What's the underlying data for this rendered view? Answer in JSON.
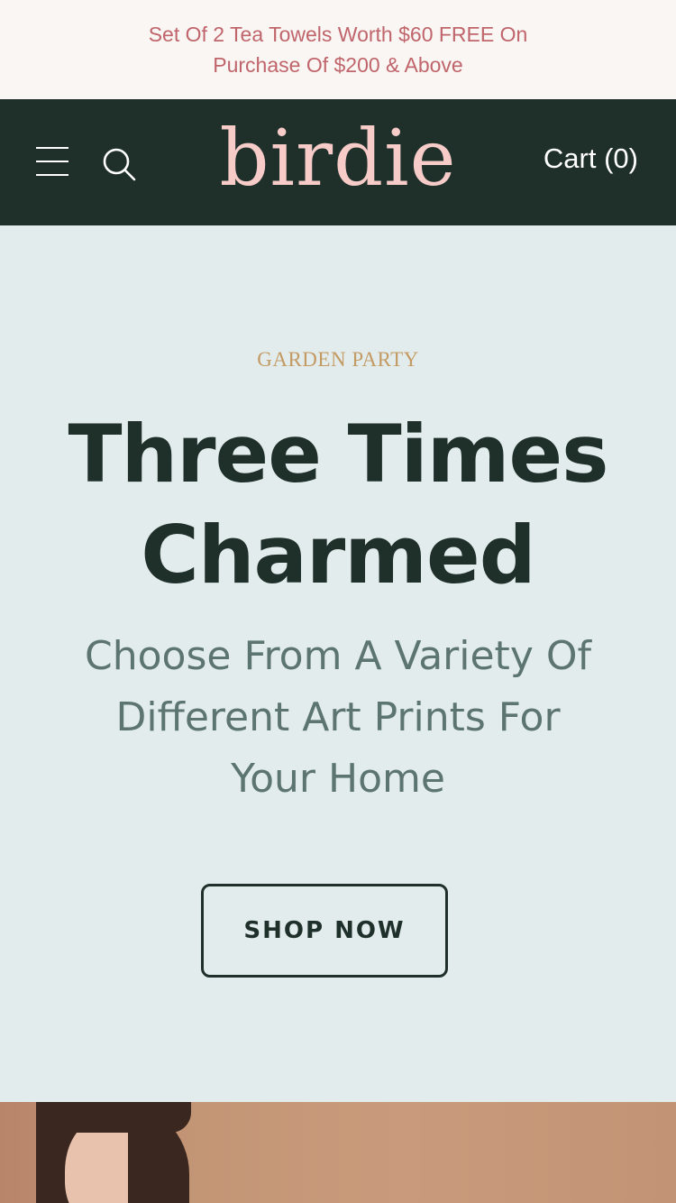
{
  "announcement": {
    "text": "Set Of 2 Tea Towels Worth $60 FREE On Purchase Of $200 & Above"
  },
  "header": {
    "menu_icon": "hamburger-menu-icon",
    "search_icon": "search-icon",
    "logo": "birdie",
    "cart_label": "Cart (0)"
  },
  "hero": {
    "eyebrow": "GARDEN PARTY",
    "headline": "Three Times Charmed",
    "subhead": "Choose From A Variety Of Different Art Prints For Your Home",
    "cta_label": "SHOP NOW"
  },
  "colors": {
    "announcement_bg": "#f9f6f3",
    "announcement_text": "#c0656b",
    "header_bg": "#1f302b",
    "logo": "#f6cbc8",
    "hero_bg": "#e3ecec",
    "eyebrow": "#c39a63",
    "headline": "#1f302b",
    "subhead": "#5c7570"
  }
}
